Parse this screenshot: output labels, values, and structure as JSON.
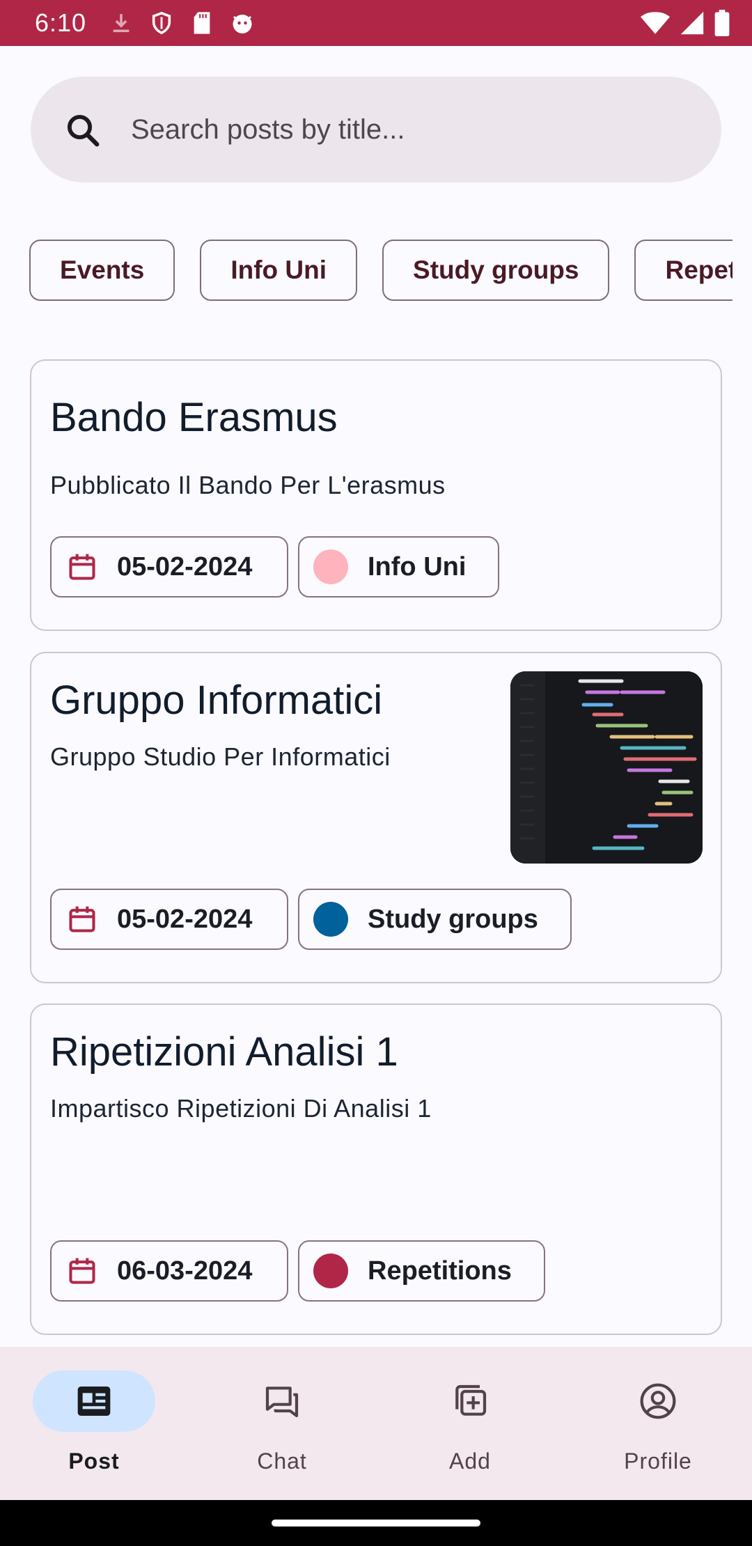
{
  "status_bar": {
    "time": "6:10",
    "left_icons": [
      "download-icon",
      "shield-icon",
      "sd-card-icon",
      "cat-face-icon"
    ],
    "right_icons": [
      "wifi-icon",
      "signal-icon",
      "battery-icon"
    ],
    "background": "#b02647"
  },
  "search": {
    "placeholder": "Search posts by title..."
  },
  "filters": [
    {
      "label": "Events"
    },
    {
      "label": "Info Uni"
    },
    {
      "label": "Study groups"
    },
    {
      "label": "Repetit"
    }
  ],
  "posts": [
    {
      "title": "Bando Erasmus",
      "description": "Pubblicato Il Bando Per L'erasmus",
      "date": "05-02-2024",
      "category": "Info Uni",
      "category_color": "#ffb3bd",
      "has_image": false
    },
    {
      "title": "Gruppo Informatici",
      "description": "Gruppo Studio Per Informatici",
      "date": "05-02-2024",
      "category": "Study groups",
      "category_color": "#00619b",
      "has_image": true,
      "image_description": "code editor screenshot"
    },
    {
      "title": "Ripetizioni Analisi 1",
      "description": "Impartisco Ripetizioni Di Analisi 1",
      "date": "06-03-2024",
      "category": "Repetitions",
      "category_color": "#b02647",
      "has_image": false
    }
  ],
  "bottom_nav": {
    "items": [
      {
        "label": "Post",
        "icon": "news-icon",
        "active": true
      },
      {
        "label": "Chat",
        "icon": "chat-icon",
        "active": false
      },
      {
        "label": "Add",
        "icon": "add-icon",
        "active": false
      },
      {
        "label": "Profile",
        "icon": "profile-icon",
        "active": false
      }
    ],
    "active_indicator_color": "#cfe4ff"
  }
}
